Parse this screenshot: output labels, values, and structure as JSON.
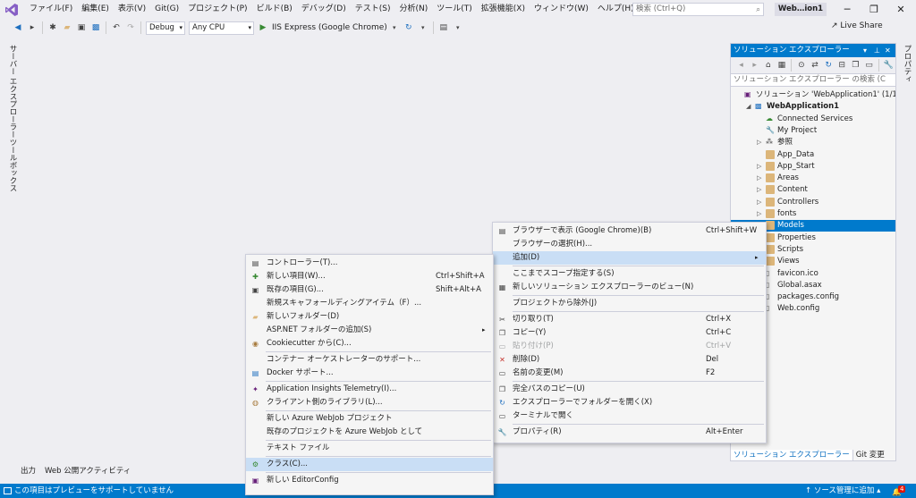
{
  "colors": {
    "accent": "#007acc",
    "highlight": "#c9def5",
    "background": "#eeeef2"
  },
  "menubar": {
    "logo_icon": "visual-studio-logo-icon",
    "items": [
      "ファイル(F)",
      "編集(E)",
      "表示(V)",
      "Git(G)",
      "プロジェクト(P)",
      "ビルド(B)",
      "デバッグ(D)",
      "テスト(S)",
      "分析(N)",
      "ツール(T)",
      "拡張機能(X)",
      "ウィンドウ(W)",
      "ヘルプ(H)"
    ],
    "search_placeholder": "検索 (Ctrl+Q)",
    "solution_name": "Web…ion1"
  },
  "toolbar": {
    "config": "Debug",
    "platform": "Any CPU",
    "run_target": "IIS Express (Google Chrome)",
    "live_share": "Live Share"
  },
  "side_tabs": {
    "server_explorer": "サーバー エクスプローラー",
    "toolbox": "ツールボックス",
    "properties": "プロパティ"
  },
  "solution_explorer": {
    "title": "ソリューション エクスプローラー",
    "search_placeholder": "ソリューション エクスプローラー の検索 (C",
    "tree": [
      {
        "label": "ソリューション 'WebApplication1' (1/1 プ",
        "indent": 0,
        "expander": "",
        "icon": "solution-icon"
      },
      {
        "label": "WebApplication1",
        "indent": 1,
        "expander": "◢",
        "icon": "project-icon",
        "bold": true
      },
      {
        "label": "Connected Services",
        "indent": 2,
        "expander": "",
        "icon": "connected-services-icon"
      },
      {
        "label": "My Project",
        "indent": 2,
        "expander": "",
        "icon": "wrench-icon"
      },
      {
        "label": "参照",
        "indent": 2,
        "expander": "▷",
        "icon": "references-icon"
      },
      {
        "label": "App_Data",
        "indent": 2,
        "expander": "",
        "icon": "folder-icon"
      },
      {
        "label": "App_Start",
        "indent": 2,
        "expander": "▷",
        "icon": "folder-icon"
      },
      {
        "label": "Areas",
        "indent": 2,
        "expander": "▷",
        "icon": "folder-icon"
      },
      {
        "label": "Content",
        "indent": 2,
        "expander": "▷",
        "icon": "folder-icon"
      },
      {
        "label": "Controllers",
        "indent": 2,
        "expander": "▷",
        "icon": "folder-icon"
      },
      {
        "label": "fonts",
        "indent": 2,
        "expander": "▷",
        "icon": "folder-icon"
      },
      {
        "label": "Models",
        "indent": 2,
        "expander": "",
        "icon": "folder-icon",
        "selected": true
      },
      {
        "label": "Properties",
        "indent": 2,
        "expander": "",
        "icon": "folder-icon"
      },
      {
        "label": "Scripts",
        "indent": 2,
        "expander": "",
        "icon": "folder-icon"
      },
      {
        "label": "Views",
        "indent": 2,
        "expander": "",
        "icon": "folder-icon"
      },
      {
        "label": "favicon.ico",
        "indent": 2,
        "expander": "",
        "icon": "file-icon"
      },
      {
        "label": "Global.asax",
        "indent": 2,
        "expander": "",
        "icon": "file-icon"
      },
      {
        "label": "packages.config",
        "indent": 2,
        "expander": "",
        "icon": "file-icon"
      },
      {
        "label": "Web.config",
        "indent": 2,
        "expander": "",
        "icon": "file-icon"
      }
    ],
    "tabs": [
      "ソリューション エクスプローラー",
      "Git 変更"
    ]
  },
  "bottom_tabs": [
    "出力",
    "Web 公開アクティビティ"
  ],
  "statusbar": {
    "message": "この項目はプレビューをサポートしていません",
    "source_control": "ソース管理に追加",
    "notification_count": "4"
  },
  "context_menu": [
    {
      "label": "ブラウザーで表示 (Google Chrome)(B)",
      "key": "Ctrl+Shift+W",
      "icon": "browser-icon"
    },
    {
      "label": "ブラウザーの選択(H)...",
      "key": "",
      "icon": ""
    },
    {
      "label": "追加(D)",
      "key": "",
      "icon": "",
      "submenu": true,
      "highlighted": true
    },
    {
      "label": "ここまでスコープ指定する(S)",
      "key": "",
      "icon": ""
    },
    {
      "label": "新しいソリューション エクスプローラーのビュー(N)",
      "key": "",
      "icon": "new-view-icon"
    },
    {
      "label": "プロジェクトから除外(J)",
      "key": "",
      "icon": ""
    },
    {
      "label": "切り取り(T)",
      "key": "Ctrl+X",
      "icon": "cut-icon"
    },
    {
      "label": "コピー(Y)",
      "key": "Ctrl+C",
      "icon": "copy-icon"
    },
    {
      "label": "貼り付け(P)",
      "key": "Ctrl+V",
      "icon": "paste-icon",
      "disabled": true
    },
    {
      "label": "削除(D)",
      "key": "Del",
      "icon": "delete-icon"
    },
    {
      "label": "名前の変更(M)",
      "key": "F2",
      "icon": "rename-icon"
    },
    {
      "label": "完全パスのコピー(U)",
      "key": "",
      "icon": "copy-path-icon"
    },
    {
      "label": "エクスプローラーでフォルダーを開く(X)",
      "key": "",
      "icon": "open-folder-icon"
    },
    {
      "label": "ターミナルで開く",
      "key": "",
      "icon": "terminal-icon"
    },
    {
      "label": "プロパティ(R)",
      "key": "Alt+Enter",
      "icon": "properties-icon"
    }
  ],
  "add_submenu": [
    {
      "label": "コントローラー(T)...",
      "key": "",
      "icon": "controller-icon"
    },
    {
      "label": "新しい項目(W)...",
      "key": "Ctrl+Shift+A",
      "icon": "new-item-icon"
    },
    {
      "label": "既存の項目(G)...",
      "key": "Shift+Alt+A",
      "icon": "existing-item-icon"
    },
    {
      "label": "新規スキャフォールディングアイテム（F）...",
      "key": "",
      "icon": ""
    },
    {
      "label": "新しいフォルダー(D)",
      "key": "",
      "icon": "new-folder-icon"
    },
    {
      "label": "ASP.NET フォルダーの追加(S)",
      "key": "",
      "icon": "",
      "submenu": true
    },
    {
      "label": "Cookiecutter から(C)...",
      "key": "",
      "icon": "cookiecutter-icon"
    },
    {
      "label": "コンテナー オーケストレーターのサポート...",
      "key": "",
      "icon": ""
    },
    {
      "label": "Docker サポート...",
      "key": "",
      "icon": "docker-icon"
    },
    {
      "label": "Application Insights Telemetry(I)...",
      "key": "",
      "icon": "app-insights-icon"
    },
    {
      "label": "クライアント側のライブラリ(L)...",
      "key": "",
      "icon": "client-library-icon"
    },
    {
      "label": "新しい Azure WebJob プロジェクト",
      "key": "",
      "icon": ""
    },
    {
      "label": "既存のプロジェクトを Azure WebJob として",
      "key": "",
      "icon": ""
    },
    {
      "label": "テキスト ファイル",
      "key": "",
      "icon": ""
    },
    {
      "label": "クラス(C)...",
      "key": "",
      "icon": "class-icon",
      "highlighted": true
    },
    {
      "label": "新しい EditorConfig",
      "key": "",
      "icon": "editorconfig-icon"
    }
  ]
}
